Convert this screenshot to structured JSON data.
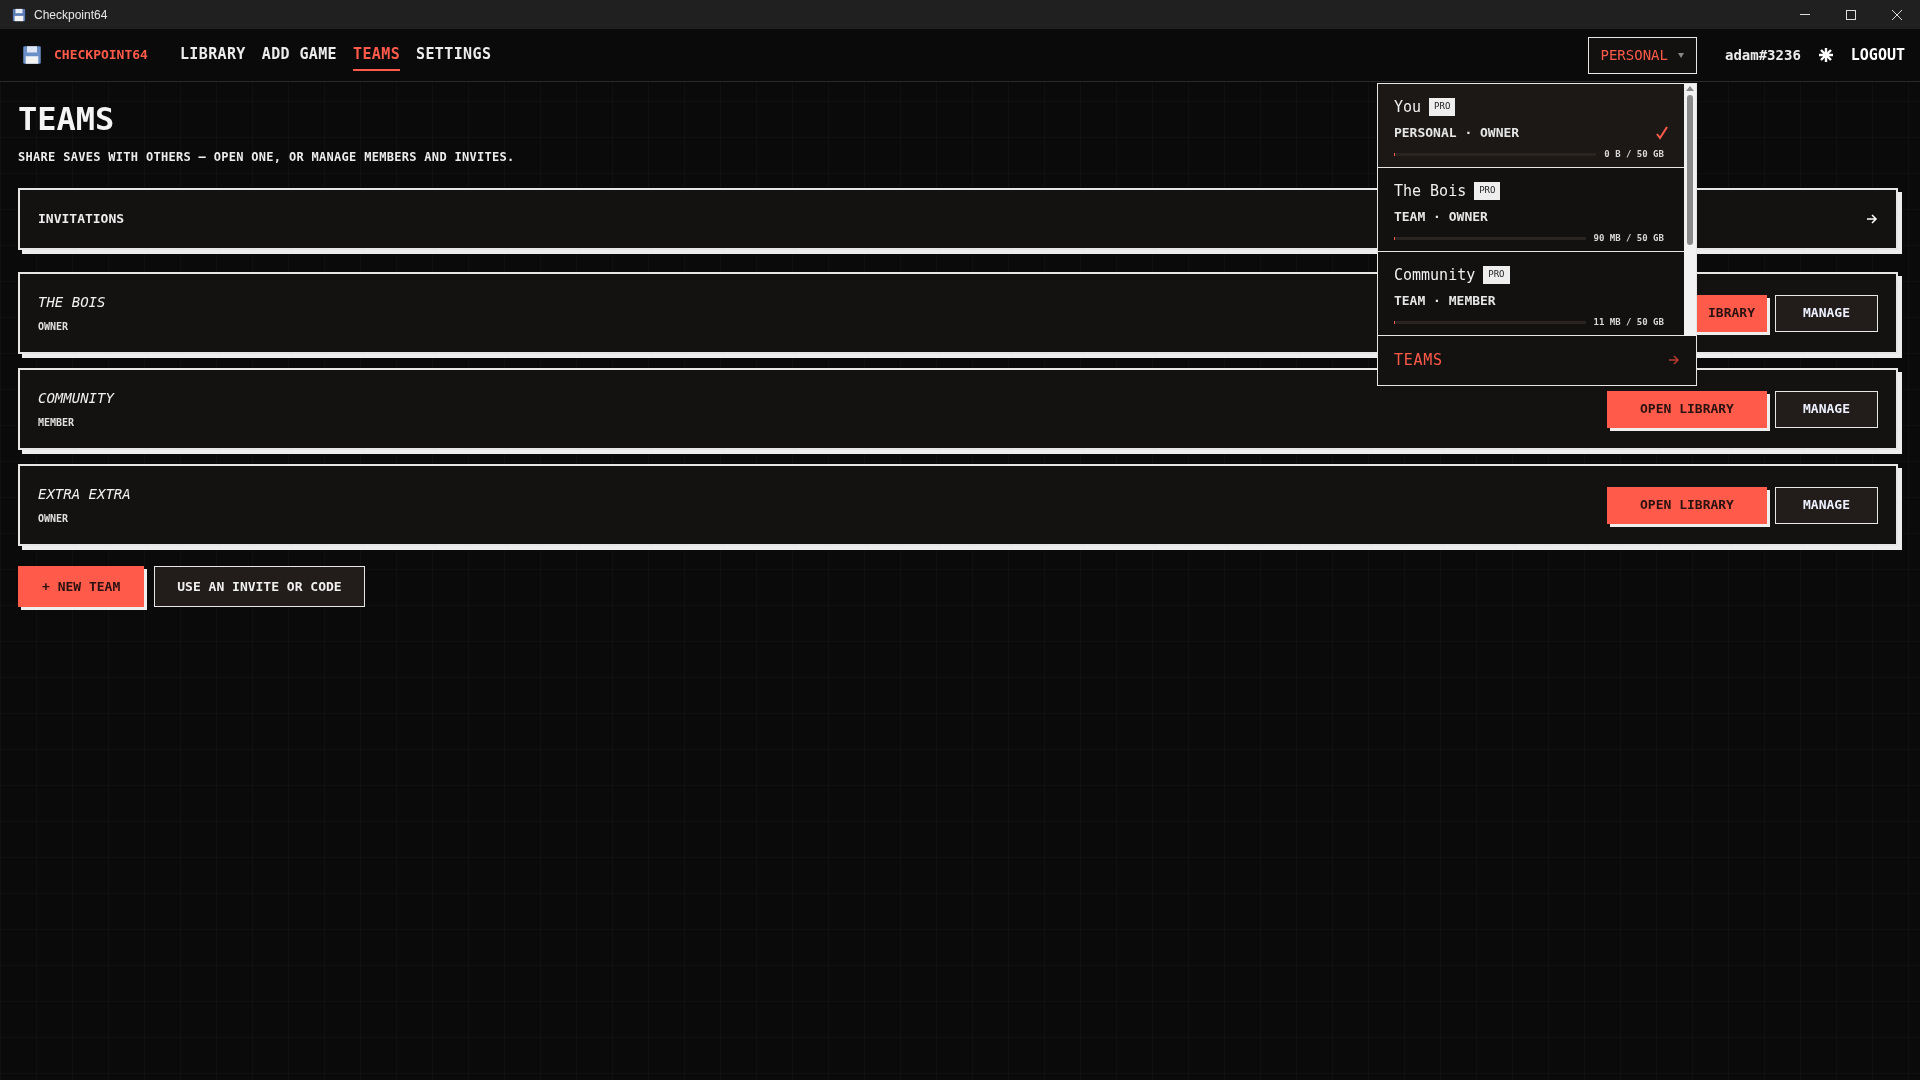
{
  "window": {
    "title": "Checkpoint64"
  },
  "nav": {
    "brand": "CHECKPOINT64",
    "items": [
      {
        "label": "LIBRARY",
        "selected": false
      },
      {
        "label": "ADD GAME",
        "selected": false
      },
      {
        "label": "TEAMS",
        "selected": true
      },
      {
        "label": "SETTINGS",
        "selected": false
      }
    ],
    "context_button": "PERSONAL",
    "user": "adam#3236",
    "logout": "LOGOUT"
  },
  "page": {
    "title": "TEAMS",
    "subtitle": "SHARE SAVES WITH OTHERS — OPEN ONE, OR MANAGE MEMBERS AND INVITES.",
    "invitations": "INVITATIONS",
    "teams": [
      {
        "name": "THE BOIS",
        "role": "OWNER",
        "open": "IBRARY",
        "manage": "MANAGE"
      },
      {
        "name": "COMMUNITY",
        "role": "MEMBER",
        "open": "OPEN LIBRARY",
        "manage": "MANAGE"
      },
      {
        "name": "EXTRA EXTRA",
        "role": "OWNER",
        "open": "OPEN LIBRARY",
        "manage": "MANAGE"
      }
    ],
    "actions": {
      "new_team": "+ NEW TEAM",
      "use_invite": "USE AN INVITE OR CODE"
    }
  },
  "dropdown": {
    "items": [
      {
        "name": "You",
        "badge": "PRO",
        "subtitle": "PERSONAL · OWNER",
        "usage": "0 B / 50 GB",
        "level": 0,
        "selected": true
      },
      {
        "name": "The Bois",
        "badge": "PRO",
        "subtitle": "TEAM · OWNER",
        "usage": "90 MB / 50 GB",
        "level": 0.002,
        "selected": false
      },
      {
        "name": "Community",
        "badge": "PRO",
        "subtitle": "TEAM · MEMBER",
        "usage": "11 MB / 50 GB",
        "level": 0.001,
        "selected": false
      }
    ],
    "footer": "TEAMS"
  }
}
